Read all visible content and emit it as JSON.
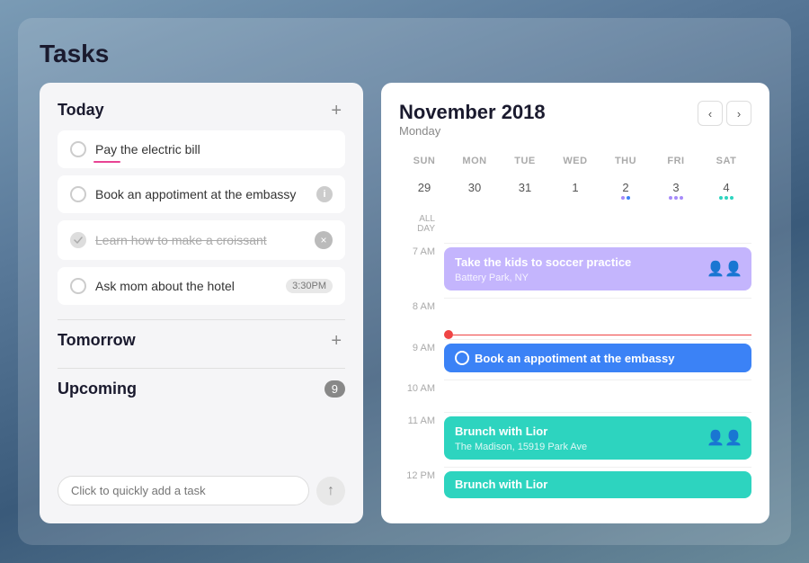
{
  "app": {
    "title": "Tasks"
  },
  "left": {
    "today_label": "Today",
    "tomorrow_label": "Tomorrow",
    "upcoming_label": "Upcoming",
    "upcoming_count": "9",
    "tasks_today": [
      {
        "id": "task1",
        "text": "Pay the electric bill",
        "done": false,
        "has_underline": true
      },
      {
        "id": "task2",
        "text": "Book an appotiment at the embassy",
        "done": false,
        "has_info": true
      },
      {
        "id": "task3",
        "text": "Learn how to make a croissant",
        "done": true,
        "strikethrough": true
      },
      {
        "id": "task4",
        "text": "Ask mom about the hotel",
        "done": false,
        "time": "3:30PM"
      }
    ],
    "quick_add_placeholder": "Click to quickly add a task"
  },
  "right": {
    "month": "November 2018",
    "day_name": "Monday",
    "week_days": [
      "SUN",
      "MON",
      "TUE",
      "WED",
      "THU",
      "FRI",
      "SAT"
    ],
    "week_dates": [
      {
        "num": "29",
        "today": false,
        "dots": []
      },
      {
        "num": "30",
        "today": false,
        "dots": []
      },
      {
        "num": "31",
        "today": true,
        "dots": []
      },
      {
        "num": "1",
        "today": false,
        "dots": []
      },
      {
        "num": "2",
        "today": false,
        "dots": [
          "purple",
          "blue"
        ]
      },
      {
        "num": "3",
        "today": false,
        "dots": [
          "purple",
          "purple",
          "purple"
        ]
      },
      {
        "num": "4",
        "today": false,
        "dots": [
          "teal",
          "teal",
          "teal"
        ]
      }
    ],
    "timeline": [
      {
        "label": "ALL DAY",
        "type": "allday"
      },
      {
        "label": "7 AM",
        "event": {
          "title": "Take the kids to soccer practice",
          "subtitle": "Battery Park, NY",
          "color": "purple",
          "has_avatars": true
        }
      },
      {
        "label": "8 AM",
        "event": null
      },
      {
        "label": "9 AM",
        "has_current_time": true,
        "event": {
          "title": "Book an appotiment at the embassy",
          "color": "blue",
          "has_circle": true
        }
      },
      {
        "label": "10 AM",
        "event": null
      },
      {
        "label": "11 AM",
        "event": {
          "title": "Brunch with Lior",
          "subtitle": "The Madison, 15919 Park Ave",
          "color": "teal",
          "has_avatars": true
        }
      },
      {
        "label": "12 PM",
        "event": {
          "title": "Brunch with Lior",
          "color": "teal"
        }
      }
    ],
    "nav": {
      "prev": "‹",
      "next": "›"
    }
  }
}
